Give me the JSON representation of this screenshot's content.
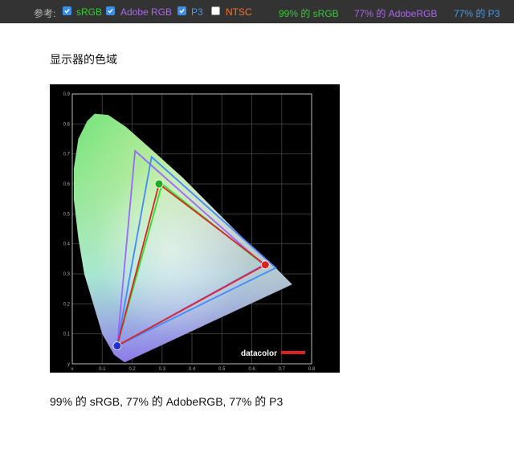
{
  "topbar": {
    "ref_label": "参考:",
    "options": [
      {
        "label": "sRGB",
        "checked": true,
        "color": "#33cc33"
      },
      {
        "label": "Adobe RGB",
        "checked": true,
        "color": "#aa66ee"
      },
      {
        "label": "P3",
        "checked": true,
        "color": "#4499ee"
      },
      {
        "label": "NTSC",
        "checked": false,
        "color": "#ee7733"
      }
    ],
    "stats": [
      {
        "text": "99% 的 sRGB",
        "color": "#33cc33"
      },
      {
        "text": "77% 的 AdobeRGB",
        "color": "#aa66ee"
      },
      {
        "text": "77% 的 P3",
        "color": "#4499ee"
      }
    ]
  },
  "content": {
    "heading": "显示器的色域",
    "caption": "99% 的 sRGB, 77% 的 AdobeRGB, 77% 的 P3"
  },
  "chart_data": {
    "type": "scatter",
    "xlim": [
      0,
      0.8
    ],
    "ylim": [
      0,
      0.9
    ],
    "x_ticks": [
      "x",
      "0.1",
      "0.2",
      "0.3",
      "0.4",
      "0.5",
      "0.6",
      "0.7",
      "0.8"
    ],
    "y_ticks": [
      "y",
      "0.1",
      "0.2",
      "0.3",
      "0.4",
      "0.5",
      "0.6",
      "0.7",
      "0.8",
      "0.9"
    ],
    "grid": true,
    "watermark": "datacolor",
    "gamuts": [
      {
        "name": "sRGB",
        "color": "#33dd33",
        "points": [
          [
            0.64,
            0.33
          ],
          [
            0.3,
            0.6
          ],
          [
            0.15,
            0.06
          ]
        ]
      },
      {
        "name": "Adobe RGB",
        "color": "#9966ff",
        "points": [
          [
            0.64,
            0.33
          ],
          [
            0.21,
            0.71
          ],
          [
            0.15,
            0.06
          ]
        ]
      },
      {
        "name": "P3",
        "color": "#4488ff",
        "points": [
          [
            0.68,
            0.32
          ],
          [
            0.265,
            0.69
          ],
          [
            0.15,
            0.06
          ]
        ]
      },
      {
        "name": "Display",
        "color": "#dd2222",
        "points": [
          [
            0.645,
            0.33
          ],
          [
            0.29,
            0.6
          ],
          [
            0.15,
            0.06
          ]
        ]
      }
    ],
    "primaries": [
      {
        "name": "red",
        "x": 0.645,
        "y": 0.33,
        "color": "#dd2222"
      },
      {
        "name": "green",
        "x": 0.29,
        "y": 0.6,
        "color": "#22aa22"
      },
      {
        "name": "blue",
        "x": 0.15,
        "y": 0.06,
        "color": "#2233dd"
      }
    ],
    "locus": [
      [
        0.175,
        0.005
      ],
      [
        0.14,
        0.03
      ],
      [
        0.1,
        0.1
      ],
      [
        0.07,
        0.2
      ],
      [
        0.04,
        0.3
      ],
      [
        0.02,
        0.42
      ],
      [
        0.005,
        0.55
      ],
      [
        0.005,
        0.65
      ],
      [
        0.02,
        0.75
      ],
      [
        0.05,
        0.81
      ],
      [
        0.075,
        0.834
      ],
      [
        0.12,
        0.83
      ],
      [
        0.18,
        0.79
      ],
      [
        0.27,
        0.71
      ],
      [
        0.37,
        0.62
      ],
      [
        0.47,
        0.52
      ],
      [
        0.57,
        0.42
      ],
      [
        0.66,
        0.34
      ],
      [
        0.735,
        0.265
      ]
    ]
  }
}
